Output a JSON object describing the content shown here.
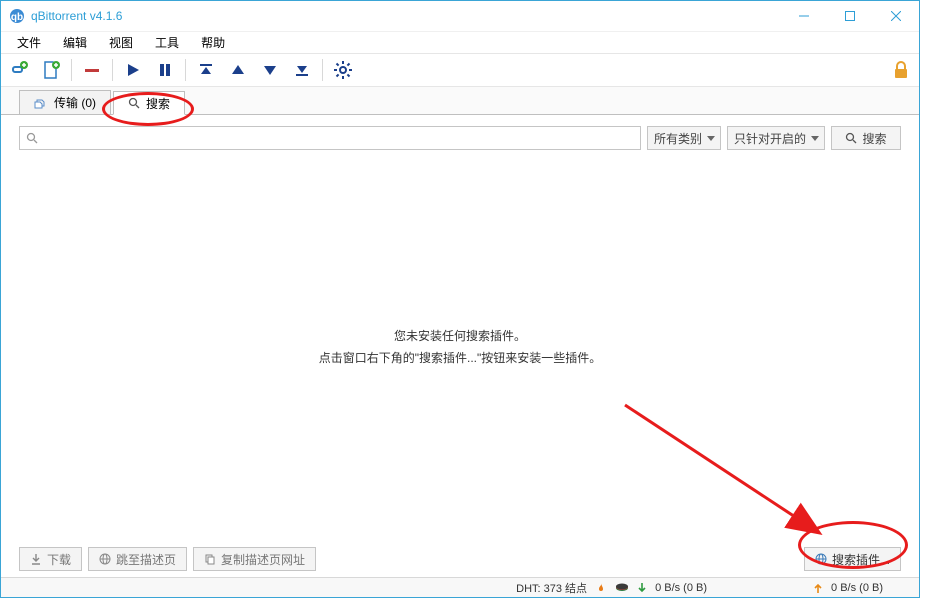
{
  "title": "qBittorrent v4.1.6",
  "menus": [
    "文件",
    "编辑",
    "视图",
    "工具",
    "帮助"
  ],
  "tabs": {
    "transfers": {
      "label": "传输 (0)"
    },
    "search": {
      "label": "搜索"
    }
  },
  "searchbar": {
    "category": "所有类别",
    "scope": "只针对开启的",
    "search_btn": "搜索"
  },
  "center": {
    "line1": "您未安装任何搜索插件。",
    "line2": "点击窗口右下角的\"搜索插件...\"按钮来安装一些插件。"
  },
  "bottom": {
    "download": "下载",
    "go_desc": "跳至描述页",
    "copy_url": "复制描述页网址",
    "plugins": "搜索插件..."
  },
  "status": {
    "dht": "DHT: 373 结点",
    "down": "0  B/s (0  B)",
    "up": "0  B/s (0  B)"
  }
}
